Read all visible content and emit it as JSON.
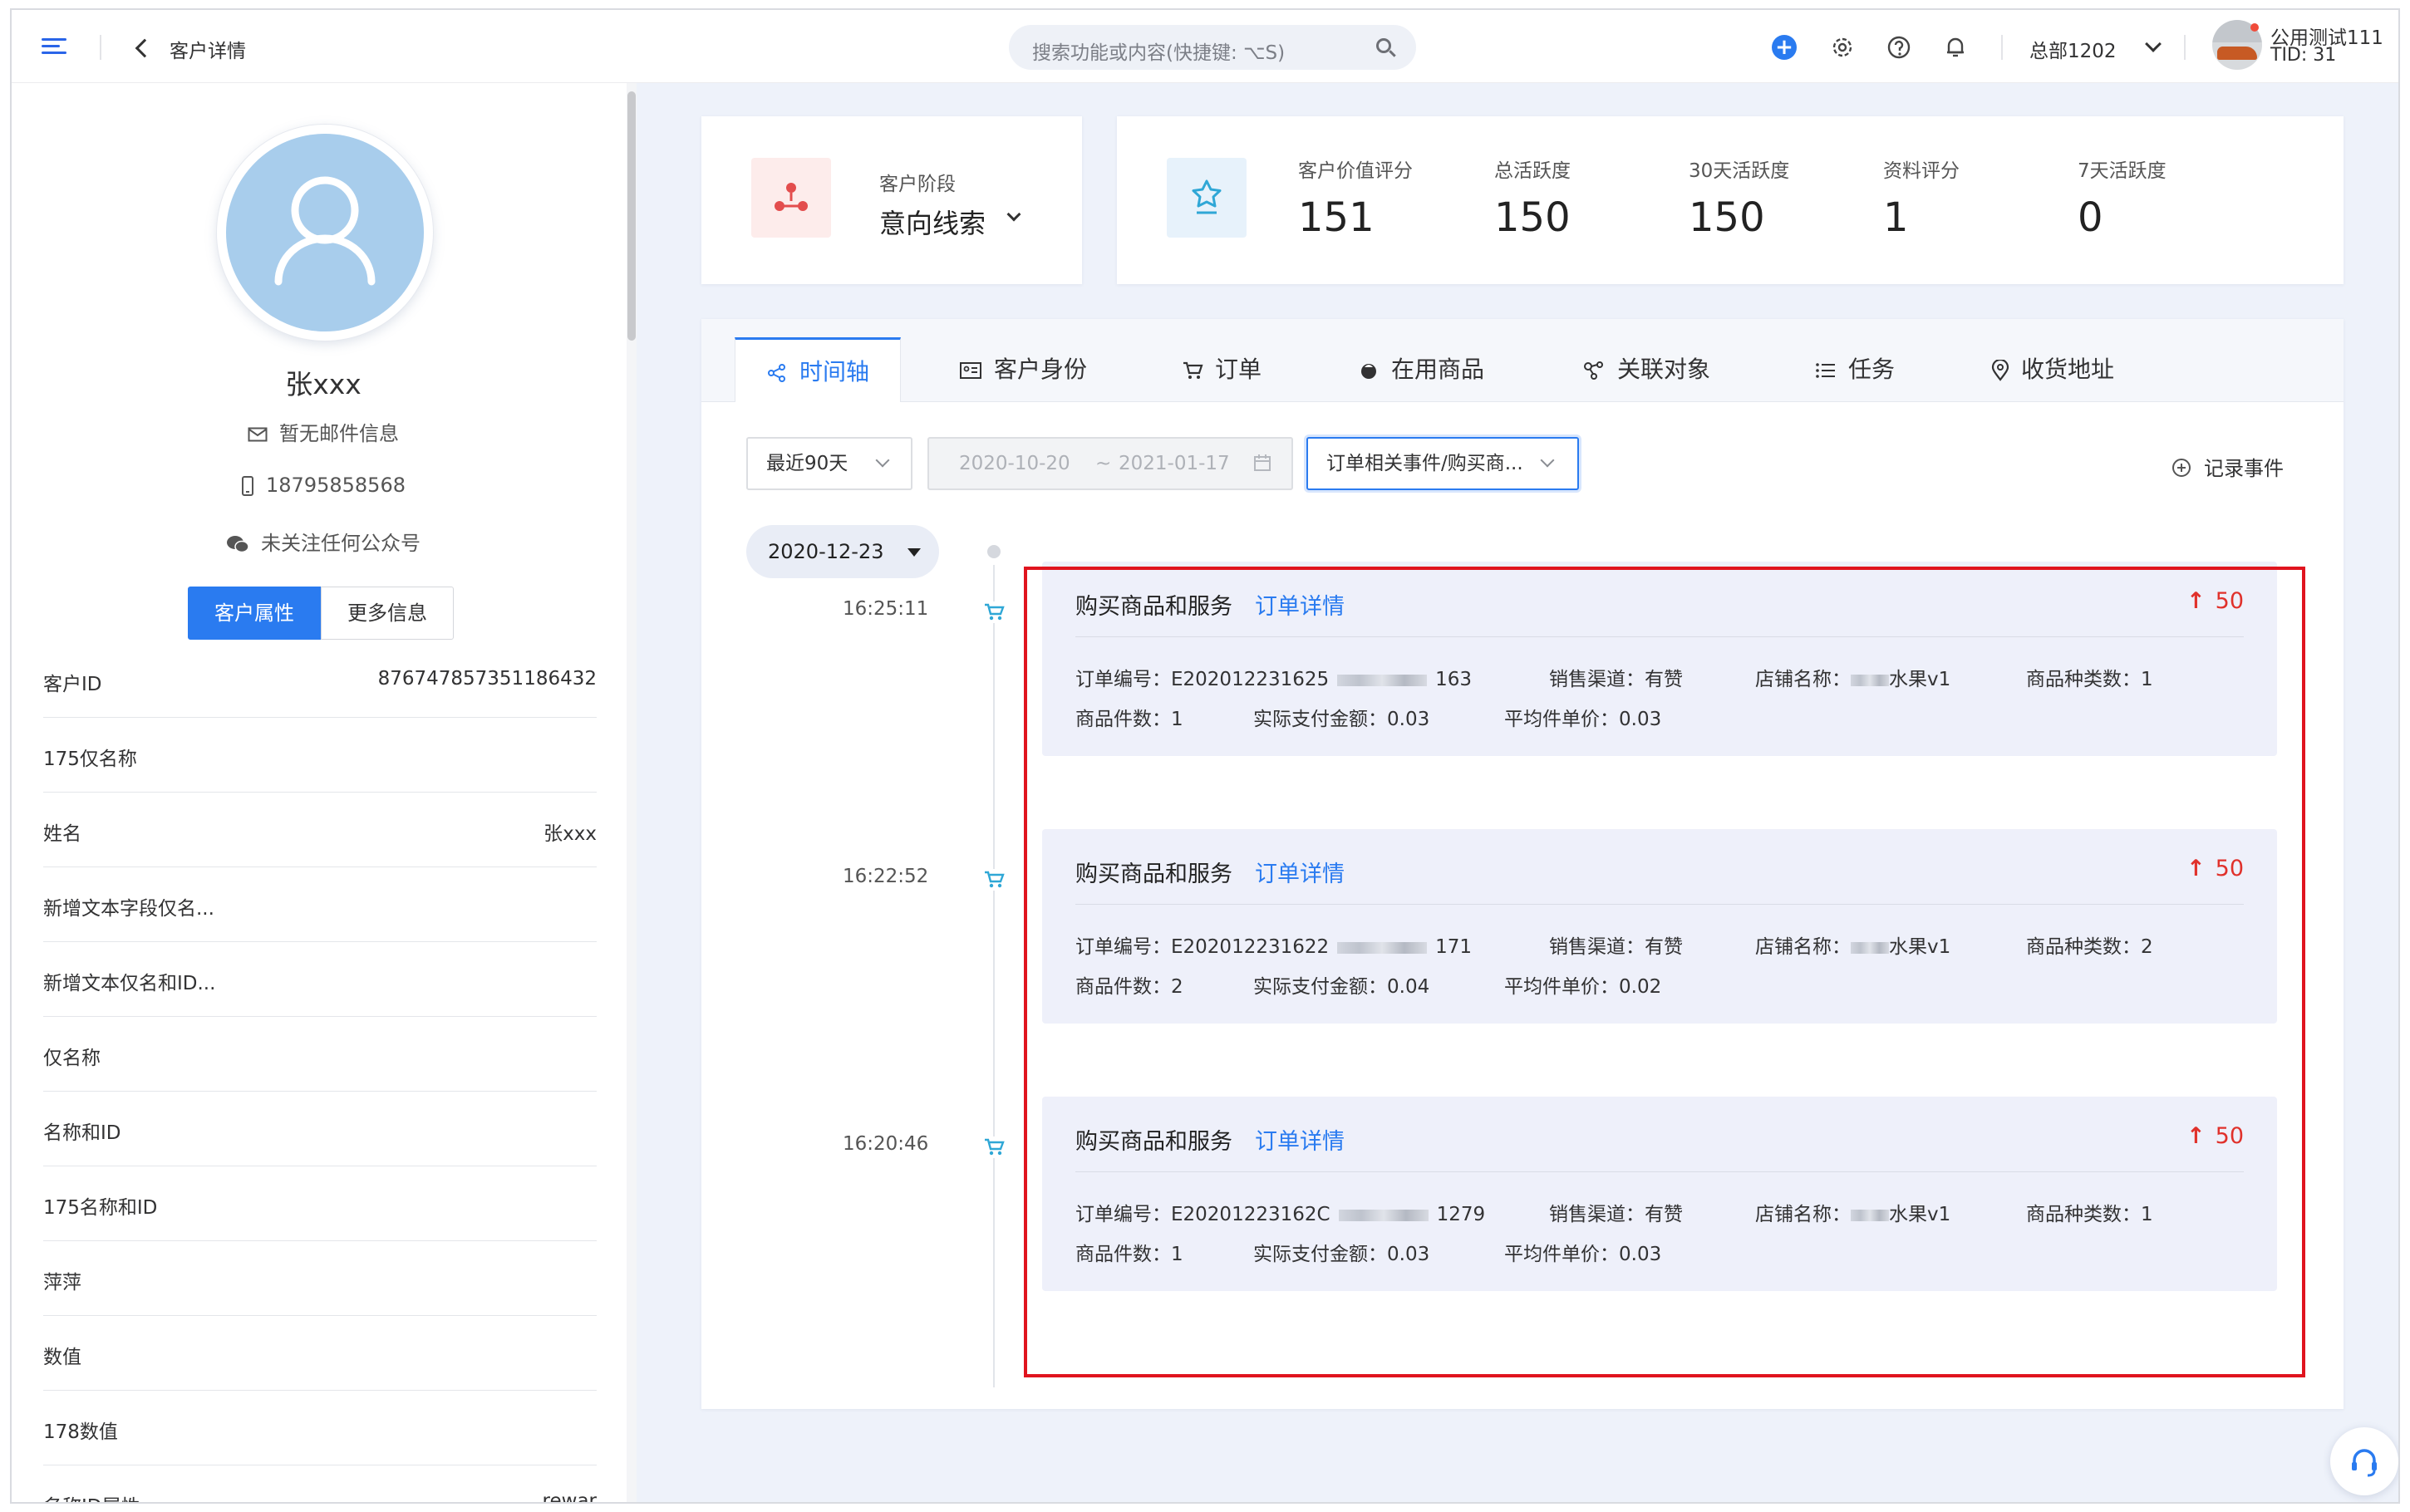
{
  "header": {
    "page_title": "客户详情",
    "search_placeholder": "搜索功能或内容(快捷键: ⌥S)",
    "tenant": "总部1202",
    "user_name": "公用测试111",
    "user_tid": "TID: 31"
  },
  "profile": {
    "name": "张xxx",
    "email": "暂无邮件信息",
    "phone": "18795858568",
    "wechat": "未关注任何公众号",
    "tab_attributes": "客户属性",
    "tab_more": "更多信息"
  },
  "attributes": [
    {
      "key": "客户ID",
      "value": "876747857351186432"
    },
    {
      "key": "175仅名称",
      "value": ""
    },
    {
      "key": "姓名",
      "value": "张xxx"
    },
    {
      "key": "新增文本字段仅名...",
      "value": ""
    },
    {
      "key": "新增文本仅名和ID...",
      "value": ""
    },
    {
      "key": "仅名称",
      "value": ""
    },
    {
      "key": "名称和ID",
      "value": ""
    },
    {
      "key": "175名称和ID",
      "value": ""
    },
    {
      "key": "萍萍",
      "value": ""
    },
    {
      "key": "数值",
      "value": ""
    },
    {
      "key": "178数值",
      "value": ""
    },
    {
      "key": "名称ID属性",
      "value": "rewar"
    }
  ],
  "stage": {
    "label": "客户阶段",
    "value": "意向线索"
  },
  "metrics": [
    {
      "label": "客户价值评分",
      "value": "151"
    },
    {
      "label": "总活跃度",
      "value": "150"
    },
    {
      "label": "30天活跃度",
      "value": "150"
    },
    {
      "label": "资料评分",
      "value": "1"
    },
    {
      "label": "7天活跃度",
      "value": "0"
    }
  ],
  "tabs": [
    "时间轴",
    "客户身份",
    "订单",
    "在用商品",
    "关联对象",
    "任务",
    "收货地址"
  ],
  "filters": {
    "period": "最近90天",
    "date_start": "2020-10-20",
    "date_sep": "~",
    "date_end": "2021-01-17",
    "event_type": "订单相关事件/购买商...",
    "record_event": "记录事件"
  },
  "timeline": {
    "date": "2020-12-23",
    "events": [
      {
        "time": "16:25:11",
        "title": "购买商品和服务",
        "link": "订单详情",
        "score": "50",
        "order_no_prefix": "订单编号：E202012231625",
        "order_no_suffix": "163",
        "channel": "销售渠道：有赞",
        "store_prefix": "店铺名称：",
        "store_suffix": "水果v1",
        "kinds": "商品种类数：1",
        "count": "商品件数：1",
        "paid": "实际支付金额：0.03",
        "avg_price": "平均件单价：0.03"
      },
      {
        "time": "16:22:52",
        "title": "购买商品和服务",
        "link": "订单详情",
        "score": "50",
        "order_no_prefix": "订单编号：E202012231622",
        "order_no_suffix": "171",
        "channel": "销售渠道：有赞",
        "store_prefix": "店铺名称：",
        "store_suffix": "水果v1",
        "kinds": "商品种类数：2",
        "count": "商品件数：2",
        "paid": "实际支付金额：0.04",
        "avg_price": "平均件单价：0.02"
      },
      {
        "time": "16:20:46",
        "title": "购买商品和服务",
        "link": "订单详情",
        "score": "50",
        "order_no_prefix": "订单编号：E20201223162C",
        "order_no_suffix": "1279",
        "channel": "销售渠道：有赞",
        "store_prefix": "店铺名称：",
        "store_suffix": "水果v1",
        "kinds": "商品种类数：1",
        "count": "商品件数：1",
        "paid": "实际支付金额：0.03",
        "avg_price": "平均件单价：0.03"
      }
    ]
  },
  "colors": {
    "accent": "#2a7bf0",
    "highlight": "#e0141e",
    "score": "#e0312b"
  }
}
